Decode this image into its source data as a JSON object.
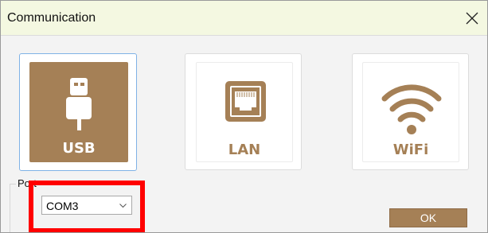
{
  "window": {
    "title": "Communication",
    "close_icon": "close-icon"
  },
  "connection_options": [
    {
      "label": "USB",
      "icon": "usb-icon",
      "selected": true
    },
    {
      "label": "LAN",
      "icon": "ethernet-port-icon",
      "selected": false
    },
    {
      "label": "WiFi",
      "icon": "wifi-icon",
      "selected": false
    }
  ],
  "port": {
    "label": "Port",
    "selected_value": "COM3",
    "dropdown_icon": "chevron-down-icon"
  },
  "ok_button": {
    "label": "OK"
  },
  "annotation": {
    "highlight_color": "#ff0000",
    "target": "port-select"
  },
  "colors": {
    "brand_brown": "#a58056",
    "titlebar_bg": "#f4f8e1",
    "selected_border": "#7fb2e6"
  }
}
